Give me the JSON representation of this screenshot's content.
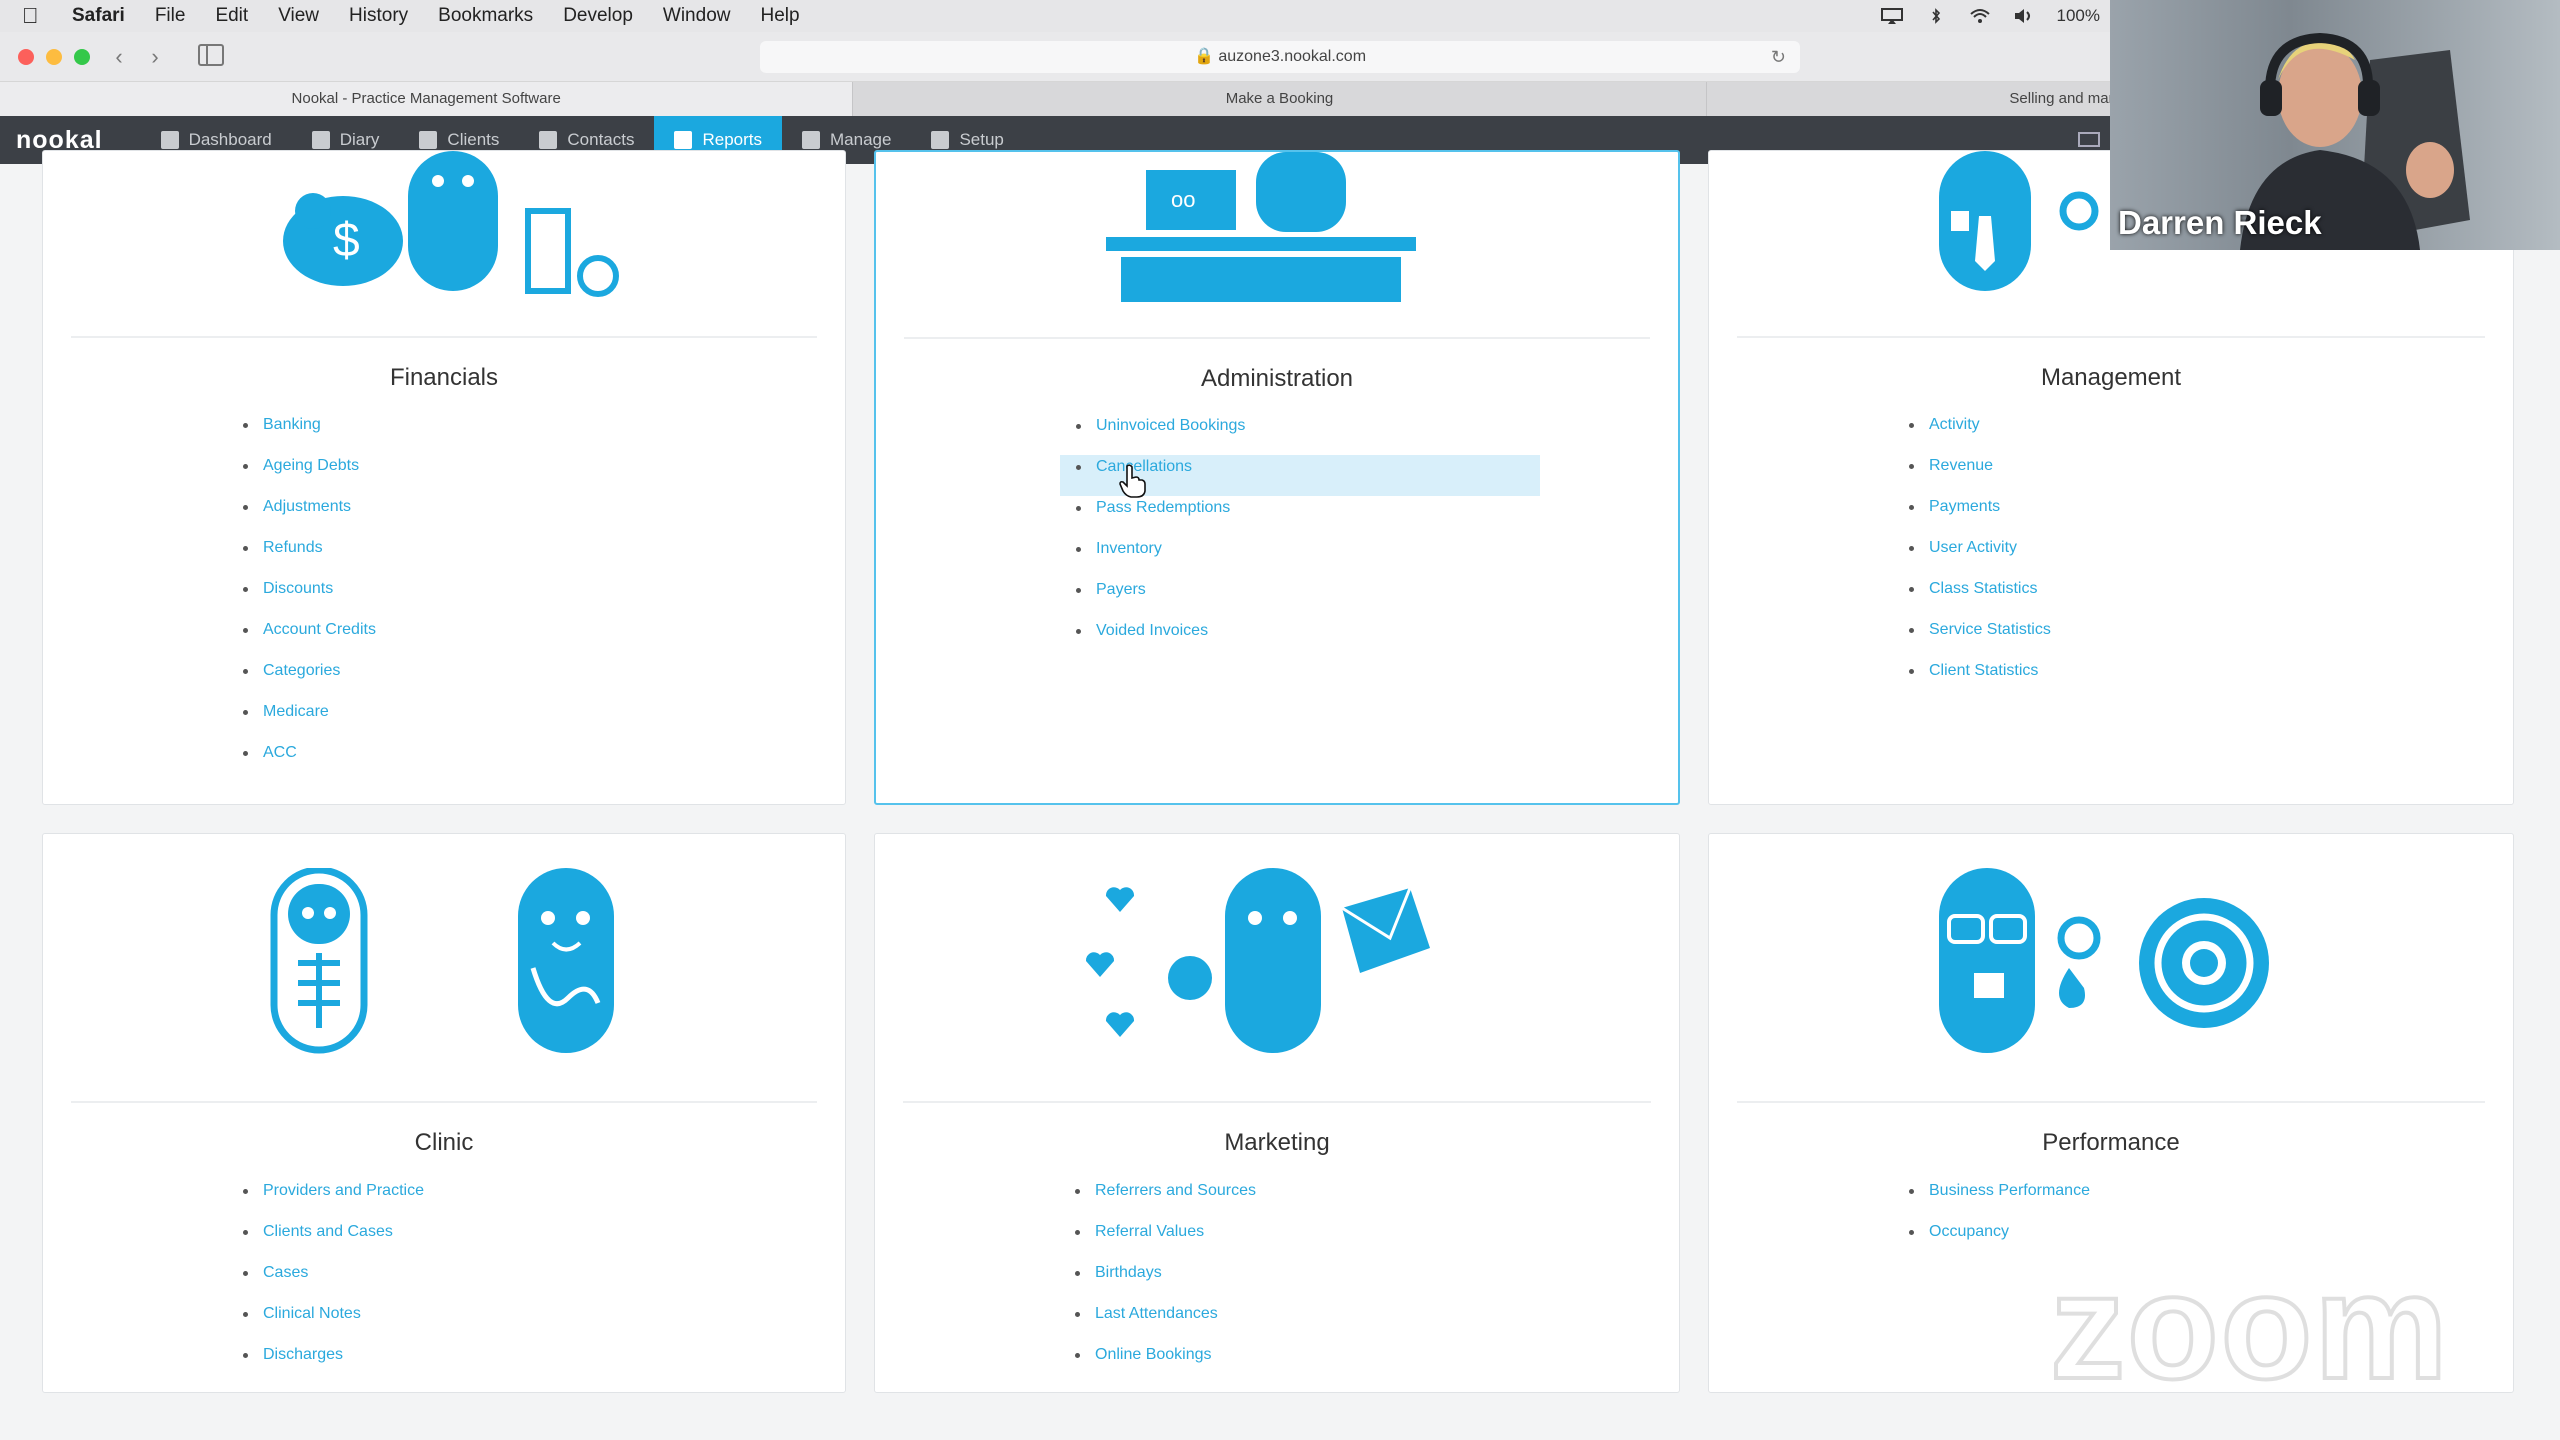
{
  "menubar": {
    "app": "Safari",
    "items": [
      "File",
      "Edit",
      "View",
      "History",
      "Bookmarks",
      "Develop",
      "Window",
      "Help"
    ],
    "battery": "100%"
  },
  "browser": {
    "url": "auzone3.nookal.com",
    "tabs": [
      {
        "label": "Nookal - Practice Management Software"
      },
      {
        "label": "Make a Booking"
      },
      {
        "label": "Selling and managing Gift Vouchers /"
      }
    ]
  },
  "appnav": {
    "logo": "nookal",
    "items": [
      {
        "label": "Dashboard",
        "icon": "home-icon"
      },
      {
        "label": "Diary",
        "icon": "diary-icon"
      },
      {
        "label": "Clients",
        "icon": "clients-icon"
      },
      {
        "label": "Contacts",
        "icon": "contacts-icon"
      },
      {
        "label": "Reports",
        "icon": "reports-icon",
        "active": true
      },
      {
        "label": "Manage",
        "icon": "wrench-icon"
      },
      {
        "label": "Setup",
        "icon": "gear-icon"
      }
    ]
  },
  "sections": {
    "financials": {
      "title": "Financials",
      "links": [
        "Banking",
        "Ageing Debts",
        "Adjustments",
        "Refunds",
        "Discounts",
        "Account Credits",
        "Categories",
        "Medicare",
        "ACC"
      ]
    },
    "administration": {
      "title": "Administration",
      "links": [
        "Uninvoiced Bookings",
        "Cancellations",
        "Pass Redemptions",
        "Inventory",
        "Payers",
        "Voided Invoices"
      ],
      "selected_link": "Cancellations"
    },
    "management": {
      "title": "Management",
      "links": [
        "Activity",
        "Revenue",
        "Payments",
        "User Activity",
        "Class Statistics",
        "Service Statistics",
        "Client Statistics"
      ]
    },
    "clinic": {
      "title": "Clinic",
      "links": [
        "Providers and Practice",
        "Clients and Cases",
        "Cases",
        "Clinical Notes",
        "Discharges"
      ]
    },
    "marketing": {
      "title": "Marketing",
      "links": [
        "Referrers and Sources",
        "Referral Values",
        "Birthdays",
        "Last Attendances",
        "Online Bookings"
      ]
    },
    "performance": {
      "title": "Performance",
      "links": [
        "Business Performance",
        "Occupancy"
      ]
    }
  },
  "webcam": {
    "name": "Darren Rieck"
  },
  "watermark": "zoom",
  "colors": {
    "accent": "#1ba8df",
    "link": "#2ba9dd",
    "nav_bg": "#3c4046",
    "illustration": "#1ba8df"
  }
}
